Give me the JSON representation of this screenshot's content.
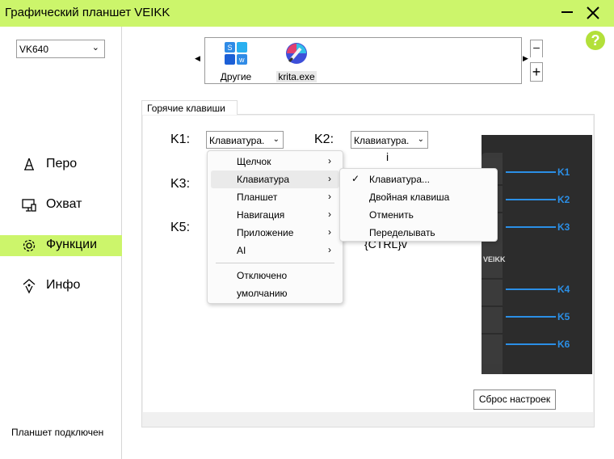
{
  "window": {
    "title": "Графический планшет VEIKK"
  },
  "sidebar": {
    "device": "VK640",
    "items": [
      {
        "label": "Перо",
        "icon": "pen-icon"
      },
      {
        "label": "Охват",
        "icon": "monitor-icon"
      },
      {
        "label": "Функции",
        "icon": "gear-icon"
      },
      {
        "label": "Инфо",
        "icon": "info-icon"
      }
    ],
    "active_item": "Функции",
    "status": "Планшет подключен"
  },
  "apps": {
    "items": [
      {
        "label": "Другие",
        "icon": "apps-grid-icon"
      },
      {
        "label": "krita.exe",
        "icon": "krita-icon"
      }
    ],
    "selected": "krita.exe"
  },
  "tab": {
    "label": "Горячие клавиши"
  },
  "keys": {
    "k1": {
      "label": "K1:",
      "combo": "Клавиатура."
    },
    "k2": {
      "label": "K2:",
      "combo": "Клавиатура.",
      "value": "i"
    },
    "k3": {
      "label": "K3:"
    },
    "k5": {
      "label": "K5:",
      "value": "{CTRL}v"
    }
  },
  "tablet": {
    "brand": "VEIKK",
    "key_labels": [
      "K1",
      "K2",
      "K3",
      "K4",
      "K5",
      "K6"
    ]
  },
  "reset_button": "Сброс настроек",
  "context_menu": {
    "items": [
      "Щелчок",
      "Клавиатура",
      "Планшет",
      "Навигация",
      "Приложение",
      "AI"
    ],
    "extra": [
      "Отключено",
      "умолчанию"
    ],
    "highlighted": "Клавиатура"
  },
  "submenu": {
    "items": [
      "Клавиатура...",
      "Двойная клавиша",
      "Отменить",
      "Переделывать"
    ],
    "checked": "Клавиатура..."
  },
  "colors": {
    "accent": "#ccf56b",
    "tablet_line": "#2b8fe6",
    "tablet_body": "#2c2c2c"
  }
}
